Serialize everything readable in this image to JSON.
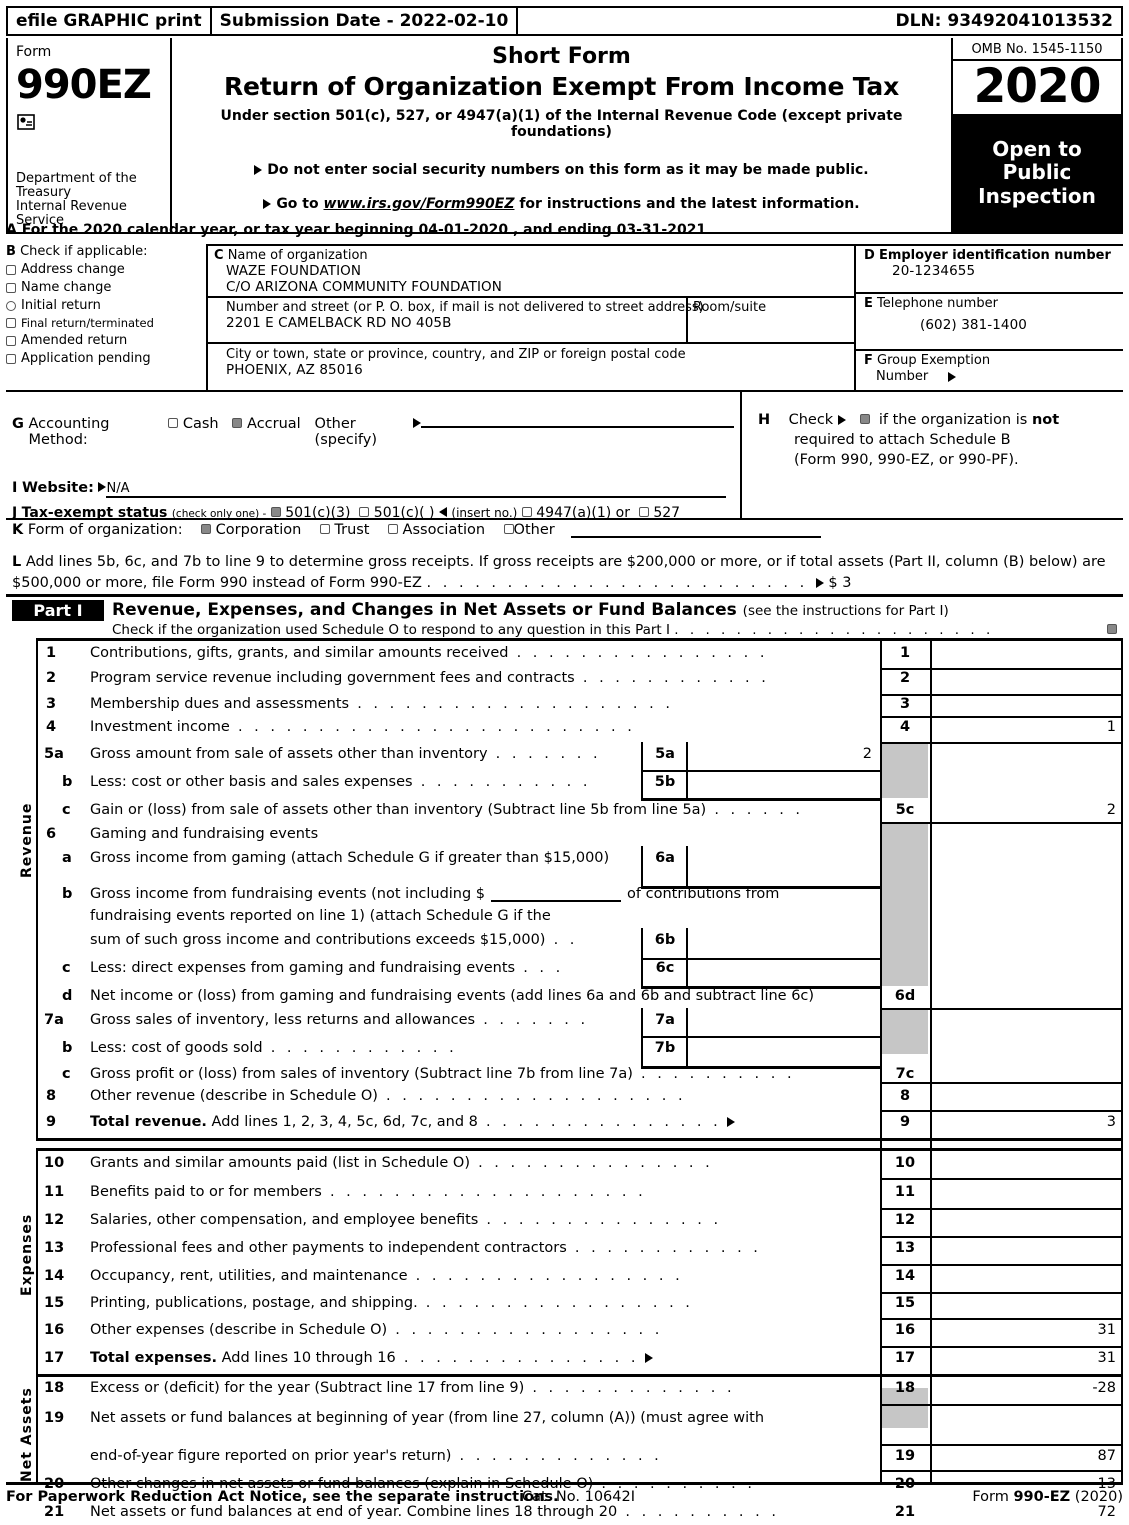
{
  "efile": {
    "graphic_print": "efile GRAPHIC print",
    "submission_date": "Submission Date - 2022-02-10",
    "dln": "DLN: 93492041013532"
  },
  "masthead": {
    "form_label": "Form",
    "form_number": "990EZ",
    "department": "Department of the Treasury",
    "department_line2": "Internal Revenue Service",
    "title_short": "Short Form",
    "title_main": "Return of Organization Exempt From Income Tax",
    "subtitle": "Under section 501(c), 527, or 4947(a)(1) of the Internal Revenue Code (except private foundations)",
    "note_ssn": "Do not enter social security numbers on this form as it may be made public.",
    "note_goto_pre": "Go to ",
    "note_goto_link": "www.irs.gov/Form990EZ",
    "note_goto_post": " for instructions and the latest information.",
    "omb": "OMB No. 1545-1150",
    "year": "2020",
    "open_to": "Open to",
    "public": "Public",
    "inspection": "Inspection"
  },
  "line_a": "A For the 2020 calendar year, or tax year beginning 04-01-2020 , and ending 03-31-2021",
  "section_b": {
    "letter": "B",
    "heading": "Check if applicable:",
    "options": [
      {
        "label": "Address change",
        "checked": false,
        "shape": "square"
      },
      {
        "label": "Name change",
        "checked": false,
        "shape": "square"
      },
      {
        "label": "Initial return",
        "checked": false,
        "shape": "round"
      },
      {
        "label": "Final return/terminated",
        "checked": false,
        "shape": "square"
      },
      {
        "label": "Amended return",
        "checked": false,
        "shape": "square"
      },
      {
        "label": "Application pending",
        "checked": false,
        "shape": "square"
      }
    ]
  },
  "section_c": {
    "letter": "C",
    "name_label": "Name of organization",
    "org_name": "WAZE FOUNDATION",
    "org_name2": "C/O ARIZONA COMMUNITY FOUNDATION",
    "street_label": "Number and street (or P. O. box, if mail is not delivered to street address)",
    "street": "2201 E CAMELBACK RD NO 405B",
    "room_label": "Room/suite",
    "room": "",
    "city_label": "City or town, state or province, country, and ZIP or foreign postal code",
    "city": "PHOENIX, AZ   85016"
  },
  "section_d": {
    "letter": "D",
    "label": "Employer identification number",
    "value": "20-1234655"
  },
  "section_e": {
    "letter": "E",
    "label": "Telephone number",
    "value": "(602) 381-1400"
  },
  "section_f": {
    "letter": "F",
    "label": "Group Exemption",
    "label2": "Number",
    "value": ""
  },
  "section_g": {
    "letter": "G",
    "label": "Accounting Method:",
    "cash": "Cash",
    "cash_checked": false,
    "accrual": "Accrual",
    "accrual_checked": true,
    "other": "Other (specify)",
    "other_value": ""
  },
  "section_h": {
    "letter": "H",
    "text1": "Check",
    "checked": true,
    "text2": "if the organization is ",
    "text2_bold": "not",
    "text3": "required to attach Schedule B",
    "text4": "(Form 990, 990-EZ, or 990-PF)."
  },
  "section_i": {
    "letter": "I",
    "label": "Website:",
    "value": "N/A"
  },
  "section_j": {
    "letter": "J",
    "label": "Tax-exempt status",
    "note": "(check only one) -",
    "options": [
      {
        "label": "501(c)(3)",
        "checked": true
      },
      {
        "label": "501(c)(   )",
        "checked": false
      },
      {
        "label": "4947(a)(1) or",
        "checked": false
      },
      {
        "label": "527",
        "checked": false
      }
    ],
    "insert_no": "(insert no.)"
  },
  "section_k": {
    "letter": "K",
    "label": "Form of organization:",
    "options": [
      {
        "label": "Corporation",
        "checked": true
      },
      {
        "label": "Trust",
        "checked": false
      },
      {
        "label": "Association",
        "checked": false
      },
      {
        "label": "Other",
        "checked": false
      }
    ]
  },
  "section_l": {
    "letter": "L",
    "text1": "Add lines 5b, 6c, and 7b to line 9 to determine gross receipts. If gross receipts are $200,000 or more, or if total assets (Part II, column (B) below) are",
    "text2": "$500,000 or more, file Form 990 instead of Form 990-EZ",
    "value": "$ 3"
  },
  "part1": {
    "tag": "Part I",
    "title": "Revenue, Expenses, and Changes in Net Assets or Fund Balances",
    "title_note": "(see the instructions for Part I)",
    "subtitle": "Check if the organization used Schedule O to respond to any question in this Part I",
    "subtitle_checked": true,
    "side_labels": {
      "revenue": "Revenue",
      "expenses": "Expenses",
      "net_assets": "Net Assets"
    },
    "lines": [
      {
        "num": "1",
        "text": "Contributions, gifts, grants, and similar amounts received",
        "box": "1",
        "amount": ""
      },
      {
        "num": "2",
        "text": "Program service revenue including government fees and contracts",
        "box": "2",
        "amount": ""
      },
      {
        "num": "3",
        "text": "Membership dues and assessments",
        "box": "3",
        "amount": ""
      },
      {
        "num": "4",
        "text": "Investment income",
        "box": "4",
        "amount": "1"
      },
      {
        "num": "5a",
        "text": "Gross amount from sale of assets other than inventory",
        "box": "5a",
        "amount": "2",
        "inner": true
      },
      {
        "num": "b",
        "text": "Less: cost or other basis and sales expenses",
        "box": "5b",
        "amount": "",
        "inner": true
      },
      {
        "num": "c",
        "text": "Gain or (loss) from sale of assets other than inventory (Subtract line 5b from line 5a)",
        "box": "5c",
        "amount": "2"
      },
      {
        "num": "6",
        "text": "Gaming and fundraising events",
        "box": "",
        "amount": ""
      },
      {
        "num": "a",
        "text": "Gross income from gaming (attach Schedule G if greater than $15,000)",
        "box": "6a",
        "amount": "",
        "inner": true
      },
      {
        "num": "b",
        "text": "Gross income from fundraising events (not including $",
        "text_b": "of contributions from",
        "text2": "fundraising events reported on line 1) (attach Schedule G if the",
        "text3": "sum of such gross income and contributions exceeds $15,000)",
        "box": "6b",
        "amount": "",
        "inner": true
      },
      {
        "num": "c",
        "text": "Less: direct expenses from gaming and fundraising events",
        "box": "6c",
        "amount": "",
        "inner": true
      },
      {
        "num": "d",
        "text": "Net income or (loss) from gaming and fundraising events (add lines 6a and 6b and subtract line 6c)",
        "box": "6d",
        "amount": ""
      },
      {
        "num": "7a",
        "text": "Gross sales of inventory, less returns and allowances",
        "box": "7a",
        "amount": "",
        "inner": true
      },
      {
        "num": "b",
        "text": "Less: cost of goods sold",
        "box": "7b",
        "amount": "",
        "inner": true
      },
      {
        "num": "c",
        "text": "Gross profit or (loss) from sales of inventory (Subtract line 7b from line 7a)",
        "box": "7c",
        "amount": ""
      },
      {
        "num": "8",
        "text": "Other revenue (describe in Schedule O)",
        "box": "8",
        "amount": ""
      },
      {
        "num": "9",
        "text": "Total revenue.",
        "text_rest": " Add lines 1, 2, 3, 4, 5c, 6d, 7c, and 8",
        "box": "9",
        "amount": "3",
        "arrow": true
      },
      {
        "num": "10",
        "text": "Grants and similar amounts paid (list in Schedule O)",
        "box": "10",
        "amount": ""
      },
      {
        "num": "11",
        "text": "Benefits paid to or for members",
        "box": "11",
        "amount": ""
      },
      {
        "num": "12",
        "text": "Salaries, other compensation, and employee benefits",
        "box": "12",
        "amount": ""
      },
      {
        "num": "13",
        "text": "Professional fees and other payments to independent contractors",
        "box": "13",
        "amount": ""
      },
      {
        "num": "14",
        "text": "Occupancy, rent, utilities, and maintenance",
        "box": "14",
        "amount": ""
      },
      {
        "num": "15",
        "text": "Printing, publications, postage, and shipping.",
        "box": "15",
        "amount": ""
      },
      {
        "num": "16",
        "text": "Other expenses (describe in Schedule O)",
        "box": "16",
        "amount": "31"
      },
      {
        "num": "17",
        "text": "Total expenses.",
        "text_rest": " Add lines 10 through 16",
        "box": "17",
        "amount": "31",
        "arrow": true
      },
      {
        "num": "18",
        "text": "Excess or (deficit) for the year (Subtract line 17 from line 9)",
        "box": "18",
        "amount": "-28"
      },
      {
        "num": "19",
        "text": "Net assets or fund balances at beginning of year (from line 27, column (A)) (must agree with",
        "text2": "end-of-year figure reported on prior year's return)",
        "box": "19",
        "amount": "87"
      },
      {
        "num": "20",
        "text": "Other changes in net assets or fund balances (explain in Schedule O)",
        "box": "20",
        "amount": "13"
      },
      {
        "num": "21",
        "text": "Net assets or fund balances at end of year. Combine lines 18 through 20",
        "box": "21",
        "amount": "72"
      }
    ]
  },
  "footer": {
    "left": "For Paperwork Reduction Act Notice, see the separate instructions.",
    "center": "Cat. No. 10642I",
    "right_pre": "Form ",
    "right_bold": "990-EZ",
    "right_post": " (2020)"
  }
}
